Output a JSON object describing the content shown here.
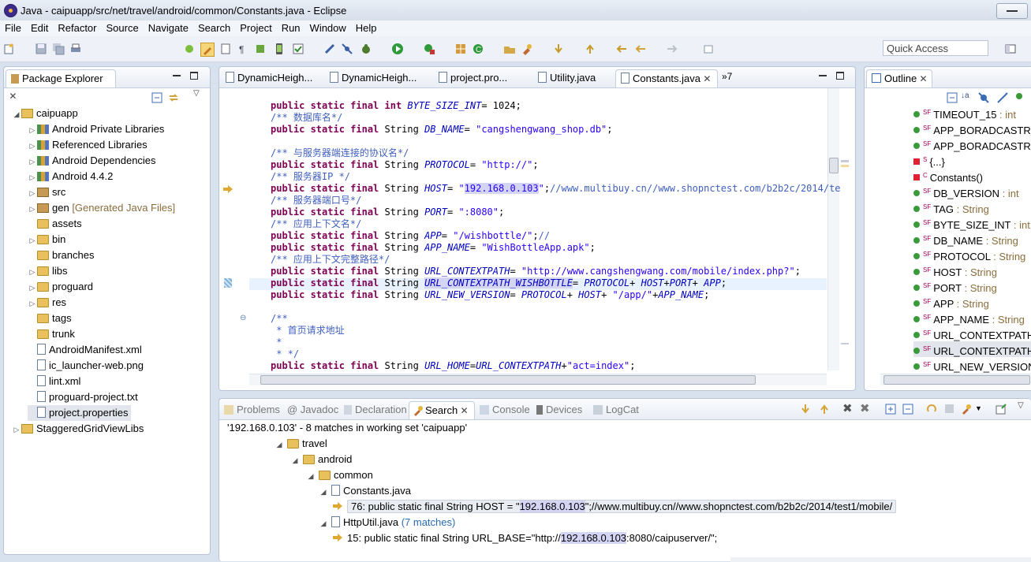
{
  "window": {
    "title": "Java - caipuapp/src/net/travel/android/common/Constants.java - Eclipse"
  },
  "menu": [
    "File",
    "Edit",
    "Refactor",
    "Source",
    "Navigate",
    "Search",
    "Project",
    "Run",
    "Window",
    "Help"
  ],
  "quick_access": {
    "placeholder": "Quick Access"
  },
  "package_explorer": {
    "tab_label": "Package Explorer",
    "tree": [
      {
        "label": "caipuapp",
        "indent": 0,
        "expanded": true,
        "icon": "project-icon"
      },
      {
        "label": "Android Private Libraries",
        "indent": 1,
        "icon": "library-icon"
      },
      {
        "label": "Referenced Libraries",
        "indent": 1,
        "icon": "library-icon"
      },
      {
        "label": "Android Dependencies",
        "indent": 1,
        "icon": "library-icon"
      },
      {
        "label": "Android 4.4.2",
        "indent": 1,
        "icon": "library-icon"
      },
      {
        "label": "src",
        "indent": 1,
        "icon": "source-folder-icon"
      },
      {
        "label": "gen",
        "suffix": "[Generated Java Files]",
        "indent": 1,
        "icon": "source-folder-icon"
      },
      {
        "label": "assets",
        "indent": 1,
        "icon": "folder-icon",
        "leaf": true
      },
      {
        "label": "bin",
        "indent": 1,
        "icon": "folder-icon"
      },
      {
        "label": "branches",
        "indent": 1,
        "icon": "folder-icon",
        "leaf": true
      },
      {
        "label": "libs",
        "indent": 1,
        "icon": "folder-icon"
      },
      {
        "label": "proguard",
        "indent": 1,
        "icon": "folder-icon"
      },
      {
        "label": "res",
        "indent": 1,
        "icon": "folder-icon"
      },
      {
        "label": "tags",
        "indent": 1,
        "icon": "folder-icon",
        "leaf": true
      },
      {
        "label": "trunk",
        "indent": 1,
        "icon": "folder-icon",
        "leaf": true
      },
      {
        "label": "AndroidManifest.xml",
        "indent": 1,
        "icon": "xml-file-icon",
        "leaf": true
      },
      {
        "label": "ic_launcher-web.png",
        "indent": 1,
        "icon": "png-file-icon",
        "leaf": true
      },
      {
        "label": "lint.xml",
        "indent": 1,
        "icon": "xml-file-icon",
        "leaf": true
      },
      {
        "label": "proguard-project.txt",
        "indent": 1,
        "icon": "text-file-icon",
        "leaf": true
      },
      {
        "label": "project.properties",
        "indent": 1,
        "icon": "text-file-icon",
        "leaf": true,
        "selected": true
      },
      {
        "label": "StaggeredGridViewLibs",
        "indent": 0,
        "icon": "project-icon"
      }
    ]
  },
  "editor": {
    "tabs": [
      "DynamicHeigh...",
      "DynamicHeigh...",
      "project.pro...",
      "Utility.java",
      "Constants.java"
    ],
    "overflow_label": "»7",
    "lines": [
      [
        [
          "kw",
          "public static final int "
        ],
        [
          "fi",
          "BYTE_SIZE_INT"
        ],
        [
          "",
          "= 1024;"
        ]
      ],
      [
        [
          "cm",
          "/** 数据库名*/"
        ]
      ],
      [
        [
          "kw",
          "public static final "
        ],
        [
          "",
          "String "
        ],
        [
          "fi",
          "DB_NAME"
        ],
        [
          "",
          "= "
        ],
        [
          "st",
          "\"cangshengwang_shop.db\""
        ],
        [
          "",
          ";"
        ]
      ],
      [
        [
          "",
          ""
        ]
      ],
      [
        [
          "cm",
          "/** 与服务器端连接的协议名*/"
        ]
      ],
      [
        [
          "kw",
          "public static final "
        ],
        [
          "",
          "String "
        ],
        [
          "fi",
          "PROTOCOL"
        ],
        [
          "",
          "= "
        ],
        [
          "st",
          "\"http://\""
        ],
        [
          "",
          ";"
        ]
      ],
      [
        [
          "cm",
          "/** 服务器IP */"
        ]
      ],
      [
        [
          "kw",
          "public static final "
        ],
        [
          "",
          "String "
        ],
        [
          "fi",
          "HOST"
        ],
        [
          "",
          "= "
        ],
        [
          "st",
          "\""
        ],
        [
          "hlst",
          "192.168.0.103"
        ],
        [
          "st",
          "\""
        ],
        [
          "",
          ";"
        ],
        [
          "cm",
          "//www.multibuy.cn//www.shopnctest.com/b2b2c/2014/te"
        ]
      ],
      [
        [
          "cm",
          "/** 服务器端口号*/"
        ]
      ],
      [
        [
          "kw",
          "public static final "
        ],
        [
          "",
          "String "
        ],
        [
          "fi",
          "PORT"
        ],
        [
          "",
          "= "
        ],
        [
          "st",
          "\":8080\""
        ],
        [
          "",
          ";"
        ]
      ],
      [
        [
          "cm",
          "/** 应用上下文名*/"
        ]
      ],
      [
        [
          "kw",
          "public static final "
        ],
        [
          "",
          "String "
        ],
        [
          "fi",
          "APP"
        ],
        [
          "",
          "= "
        ],
        [
          "st",
          "\"/wishbottle/\""
        ],
        [
          "",
          ";"
        ],
        [
          "cm",
          "//"
        ]
      ],
      [
        [
          "kw",
          "public static final "
        ],
        [
          "",
          "String "
        ],
        [
          "fi",
          "APP_NAME"
        ],
        [
          "",
          "= "
        ],
        [
          "st",
          "\"WishBottleApp.apk\""
        ],
        [
          "",
          ";"
        ]
      ],
      [
        [
          "cm",
          "/** 应用上下文完整路径*/"
        ]
      ],
      [
        [
          "kw",
          "public static final "
        ],
        [
          "",
          "String "
        ],
        [
          "fi",
          "URL_CONTEXTPATH"
        ],
        [
          "",
          "= "
        ],
        [
          "st",
          "\"http://www.cangshengwang.com/mobile/index.php?\""
        ],
        [
          "",
          ";"
        ]
      ],
      [
        [
          "kw",
          "public static final "
        ],
        [
          "",
          "String "
        ],
        [
          "hlfi",
          "URL_CONTEXTPATH_WISHBOTTLE"
        ],
        [
          "",
          "= "
        ],
        [
          "fi",
          "PROTOCOL"
        ],
        [
          "",
          "+ "
        ],
        [
          "fi",
          "HOST"
        ],
        [
          "",
          "+"
        ],
        [
          "fi",
          "PORT"
        ],
        [
          "",
          "+ "
        ],
        [
          "fi",
          "APP"
        ],
        [
          "",
          ";"
        ]
      ],
      [
        [
          "kw",
          "public static final "
        ],
        [
          "",
          "String "
        ],
        [
          "fi",
          "URL_NEW_VERSION"
        ],
        [
          "",
          "= "
        ],
        [
          "fi",
          "PROTOCOL"
        ],
        [
          "",
          "+ "
        ],
        [
          "fi",
          "HOST"
        ],
        [
          "",
          "+ "
        ],
        [
          "st",
          "\"/app/\""
        ],
        [
          "",
          "+"
        ],
        [
          "fi",
          "APP_NAME"
        ],
        [
          "",
          ";"
        ]
      ],
      [
        [
          "",
          ""
        ]
      ],
      [
        [
          "cm",
          "/**"
        ]
      ],
      [
        [
          "cm",
          " * 首页请求地址"
        ]
      ],
      [
        [
          "cm",
          " *"
        ]
      ],
      [
        [
          "cm",
          " * */"
        ]
      ],
      [
        [
          "kw",
          "public static final "
        ],
        [
          "",
          "String "
        ],
        [
          "fi",
          "URL_HOME"
        ],
        [
          "",
          "="
        ],
        [
          "fi",
          "URL_CONTEXTPATH"
        ],
        [
          "",
          "+"
        ],
        [
          "st",
          "\"act=index\""
        ],
        [
          "",
          ";"
        ]
      ]
    ]
  },
  "outline": {
    "tab_label": "Outline",
    "items": [
      {
        "name": "TIMEOUT_15",
        "type": ": int",
        "icon": "field-icon"
      },
      {
        "name": "APP_BORADCASTREC",
        "type": "",
        "icon": "field-icon"
      },
      {
        "name": "APP_BORADCASTREC",
        "type": "",
        "icon": "field-icon"
      },
      {
        "name": "{...}",
        "type": "",
        "icon": "static-block-icon"
      },
      {
        "name": "Constants()",
        "type": "",
        "icon": "constructor-icon"
      },
      {
        "name": "DB_VERSION",
        "type": ": int",
        "icon": "field-icon"
      },
      {
        "name": "TAG",
        "type": ": String",
        "icon": "field-icon"
      },
      {
        "name": "BYTE_SIZE_INT",
        "type": ": int",
        "icon": "field-icon"
      },
      {
        "name": "DB_NAME",
        "type": ": String",
        "icon": "field-icon"
      },
      {
        "name": "PROTOCOL",
        "type": ": String",
        "icon": "field-icon"
      },
      {
        "name": "HOST",
        "type": ": String",
        "icon": "field-icon"
      },
      {
        "name": "PORT",
        "type": ": String",
        "icon": "field-icon"
      },
      {
        "name": "APP",
        "type": ": String",
        "icon": "field-icon"
      },
      {
        "name": "APP_NAME",
        "type": ": String",
        "icon": "field-icon"
      },
      {
        "name": "URL_CONTEXTPATH",
        "type": ":",
        "icon": "field-icon"
      },
      {
        "name": "URL_CONTEXTPATH_",
        "type": "",
        "icon": "field-icon",
        "selected": true
      },
      {
        "name": "URL_NEW_VERSION",
        "type": ":",
        "icon": "field-icon"
      }
    ]
  },
  "bottom": {
    "tabs": [
      "Problems",
      "@ Javadoc",
      "Declaration",
      "Search",
      "Console",
      "Devices",
      "LogCat"
    ],
    "summary": "'192.168.0.103' - 8 matches in working set 'caipuapp'",
    "tree": [
      {
        "label": "travel",
        "kind": "folder"
      },
      {
        "label": "android",
        "kind": "folder"
      },
      {
        "label": "common",
        "kind": "folder"
      },
      {
        "label": "Constants.java",
        "kind": "file"
      },
      {
        "pre": "76: public static final String HOST = \"",
        "hl": "192.168.0.103",
        "post": "\";//www.multibuy.cn//www.shopnctest.com/b2b2c/2014/test1/mobile/",
        "kind": "match",
        "selected": true
      },
      {
        "label": "HttpUtil.java",
        "extra": "(7 matches)",
        "kind": "file"
      },
      {
        "pre": "15: public static final String URL_BASE=\"http://",
        "hl": "192.168.0.103",
        "post": ":8080/caipuserver/\";",
        "kind": "match"
      }
    ]
  }
}
